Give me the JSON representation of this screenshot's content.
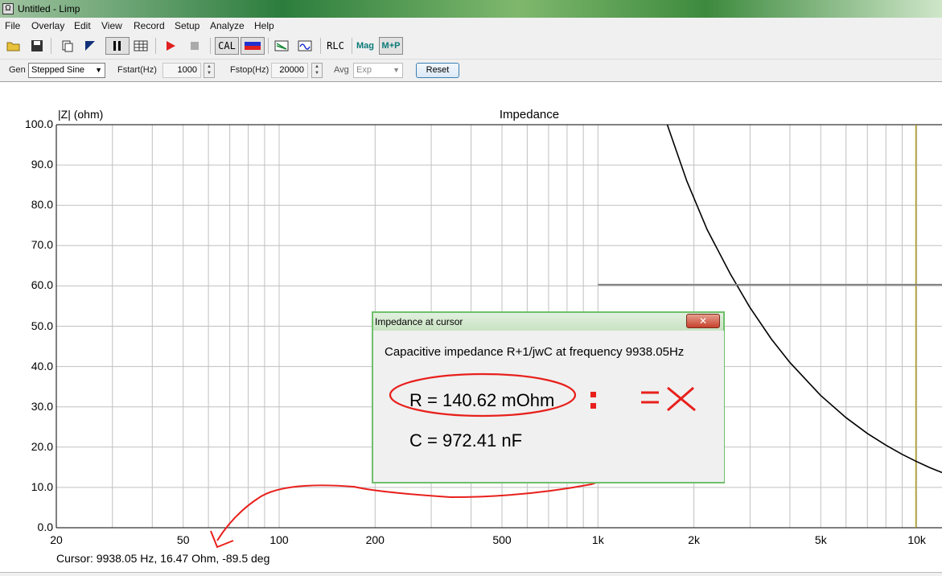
{
  "window": {
    "title": "Untitled - Limp",
    "icon": "waveform-icon"
  },
  "menu": [
    "File",
    "Overlay",
    "Edit",
    "View",
    "Record",
    "Setup",
    "Analyze",
    "Help"
  ],
  "toolbar": {
    "cal_label": "CAL",
    "rlc_label": "RLC",
    "mag_label": "Mag",
    "mp_label": "M+P",
    "icons": [
      "open-folder-icon",
      "save-icon",
      "copy-icon",
      "marker-icon",
      "pause-icon",
      "table-icon",
      "record-icon",
      "stop-icon",
      "cal-icon",
      "color-icon",
      "overlay-icon",
      "waveform-icon"
    ]
  },
  "gen_bar": {
    "gen_label": "Gen",
    "gen_value": "Stepped Sine",
    "fstart_label": "Fstart(Hz)",
    "fstart_value": "1000",
    "fstop_label": "Fstop(Hz)",
    "fstop_value": "20000",
    "avg_label": "Avg",
    "avg_value": "Exp",
    "reset_label": "Reset"
  },
  "chart_data": {
    "type": "line",
    "title": "Impedance",
    "ylabel": "|Z| (ohm)",
    "xlabel": "",
    "xscale": "log",
    "xlim": [
      20,
      12000
    ],
    "ylim": [
      0,
      100
    ],
    "grid": true,
    "y_ticks": [
      "100.0",
      "90.0",
      "80.0",
      "70.0",
      "60.0",
      "50.0",
      "40.0",
      "30.0",
      "20.0",
      "10.0",
      "0.0"
    ],
    "x_ticks": [
      {
        "value": 20,
        "label": "20"
      },
      {
        "value": 50,
        "label": "50"
      },
      {
        "value": 100,
        "label": "100"
      },
      {
        "value": 200,
        "label": "200"
      },
      {
        "value": 500,
        "label": "500"
      },
      {
        "value": 1000,
        "label": "1k"
      },
      {
        "value": 2000,
        "label": "2k"
      },
      {
        "value": 5000,
        "label": "5k"
      },
      {
        "value": 10000,
        "label": "10k"
      }
    ],
    "series": [
      {
        "color": "#000000",
        "x": [
          1650,
          1900,
          2200,
          2600,
          3000,
          3500,
          4000,
          5000,
          6000,
          7000,
          8000,
          9000,
          10000,
          11000,
          12000
        ],
        "y": [
          100,
          86,
          74,
          63,
          54.6,
          46.8,
          41,
          32.8,
          27.3,
          23.4,
          20.5,
          18.2,
          16.4,
          14.9,
          13.7
        ]
      },
      {
        "color": "#808080",
        "x": [
          1000,
          12000
        ],
        "y": [
          60.3,
          60.3
        ]
      }
    ],
    "cursor": {
      "x": 9938.05,
      "color": "#b0a020"
    }
  },
  "dialog": {
    "title": "Impedance at cursor",
    "description": "Capacitive impedance R+1/jwC at frequency 9938.05Hz",
    "r_value": "R = 140.62 mOhm",
    "c_value": "C = 972.41 nF",
    "close_symbol": "✕"
  },
  "cursor_readout": "Cursor: 9938.05 Hz, 16.47 Ohm, -89.5 deg"
}
